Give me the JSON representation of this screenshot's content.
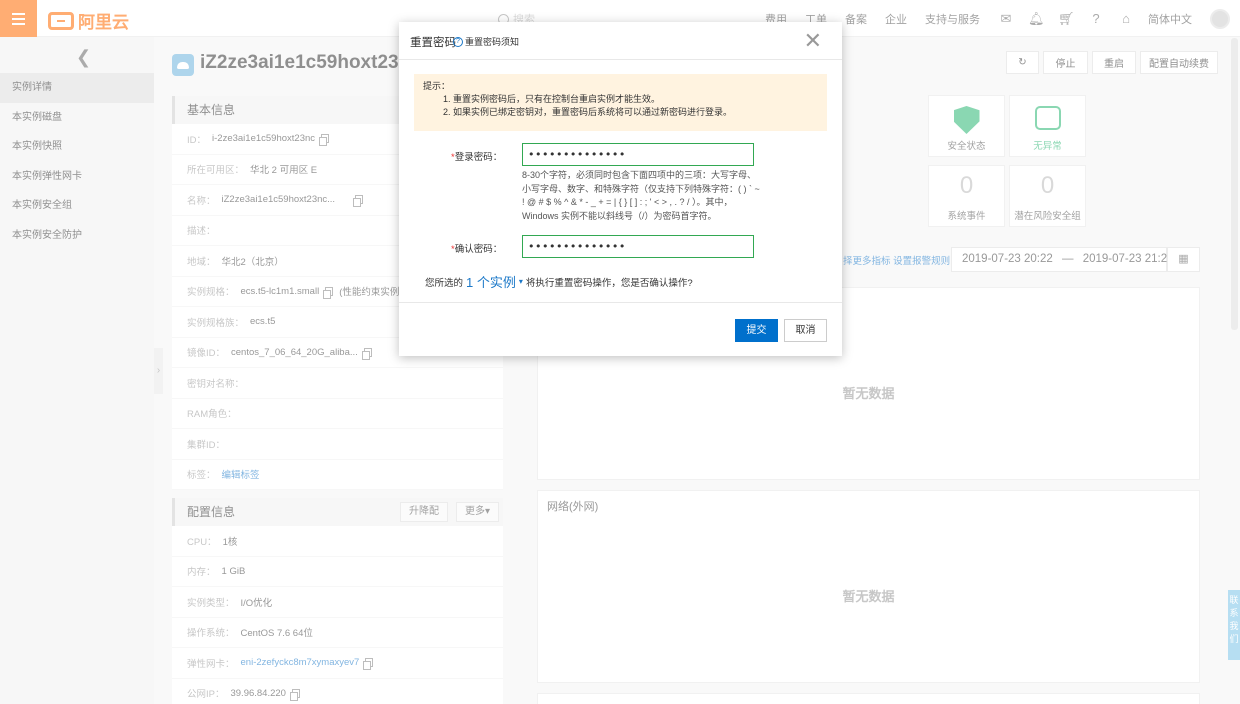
{
  "topbar": {
    "logo_text": "阿里云",
    "search_placeholder": "搜索",
    "nav": [
      "费用",
      "工单",
      "备案",
      "企业",
      "支持与服务"
    ],
    "icons": [
      "mail-icon",
      "bell-icon",
      "cart-icon",
      "help-icon",
      "home-icon"
    ],
    "lang": "简体中文"
  },
  "sidebar": {
    "items": [
      "实例详情",
      "本实例磁盘",
      "本实例快照",
      "本实例弹性网卡",
      "本实例安全组",
      "本实例安全防护"
    ]
  },
  "instance": {
    "title": "iZ2ze3ai1e1c59hoxt23nc"
  },
  "actions": [
    "停止",
    "重启",
    "配置自动续费"
  ],
  "basic_info": {
    "title": "基本信息",
    "rows": [
      {
        "k": "ID：",
        "v": "i-2ze3ai1e1c59hoxt23nc"
      },
      {
        "k": "所在可用区：",
        "v": "华北 2 可用区 E"
      },
      {
        "k": "名称：",
        "v": "iZ2ze3ai1e1c59hoxt23nc..."
      },
      {
        "k": "描述：",
        "v": ""
      },
      {
        "k": "地域：",
        "v": "华北2（北京）"
      },
      {
        "k": "实例规格：",
        "v": "ecs.t5-lc1m1.small",
        "extra": "(性能约束实例)"
      },
      {
        "k": "实例规格族：",
        "v": "ecs.t5"
      },
      {
        "k": "镜像ID：",
        "v": "centos_7_06_64_20G_aliba..."
      },
      {
        "k": "密钥对名称：",
        "v": ""
      },
      {
        "k": "RAM角色：",
        "v": ""
      },
      {
        "k": "集群ID：",
        "v": ""
      },
      {
        "k": "标签：",
        "v": "编辑标签"
      }
    ]
  },
  "config_info": {
    "title": "配置信息",
    "upgrade": "升降配",
    "more": "更多▾",
    "rows": [
      {
        "k": "CPU：",
        "v": "1核"
      },
      {
        "k": "内存：",
        "v": "1 GiB"
      },
      {
        "k": "实例类型：",
        "v": "I/O优化"
      },
      {
        "k": "操作系统：",
        "v": "CentOS 7.6 64位"
      },
      {
        "k": "弹性网卡：",
        "v": "eni-2zefyckc8m7xymaxyev7"
      },
      {
        "k": "公网IP：",
        "v": "39.96.84.220"
      }
    ]
  },
  "status_cards": [
    {
      "label": "安全状态",
      "value": ""
    },
    {
      "label": "无异常",
      "value": ""
    },
    {
      "label": "系统事件",
      "value": "0"
    },
    {
      "label": "潜在风险安全组",
      "value": "0"
    }
  ],
  "monitor": {
    "links": "择更多指标 设置报警规则",
    "date_start": "2019-07-23 20:22",
    "date_sep": "—",
    "date_end": "2019-07-23 21:22",
    "nodata": "暂无数据",
    "network_title": "网络(外网)"
  },
  "dialog": {
    "title": "重置密码",
    "help": "重置密码须知",
    "tip_title": "提示：",
    "tip_lines": [
      "1. 重置实例密码后，只有在控制台重启实例才能生效。",
      "2. 如果实例已绑定密钥对，重置密码后系统将可以通过新密码进行登录。"
    ],
    "login_label": "登录密码：",
    "login_value": "••••••••••••••",
    "hint": "8-30个字符，必须同时包含下面四项中的三项：大写字母、小写字母、数字、和特殊字符（仅支持下列特殊字符：( ) ` ~ ! @ # $ % ^ & * - _ + = | { } [ ] : ; ' < > , . ? / ）。其中，Windows 实例不能以斜线号（/）为密码首字符。",
    "confirm_label": "确认密码：",
    "confirm_value": "••••••••••••••",
    "selected_pre": "您所选的",
    "selected_count": "1 个实例",
    "selected_post": "将执行重置密码操作，您是否确认操作?",
    "submit": "提交",
    "cancel": "取消"
  },
  "float_tab": "联系我们"
}
